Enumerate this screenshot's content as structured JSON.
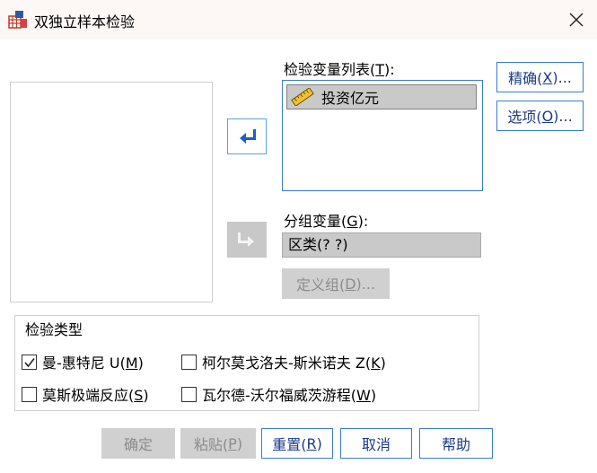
{
  "window": {
    "title": "双独立样本检验"
  },
  "test_variables": {
    "label_prefix": "检验变量列表(",
    "label_key": "T",
    "label_suffix": "):",
    "items": [
      "投资亿元"
    ]
  },
  "grouping_variable": {
    "label_prefix": "分组变量(",
    "label_key": "G",
    "label_suffix": "):",
    "value": "区类(? ?)"
  },
  "buttons": {
    "exact": {
      "prefix": "精确(",
      "key": "X",
      "suffix": ")..."
    },
    "options": {
      "prefix": "选项(",
      "key": "O",
      "suffix": ")..."
    },
    "define_groups": {
      "prefix": "定义组(",
      "key": "D",
      "suffix": ")..."
    },
    "ok": "确定",
    "paste": {
      "prefix": "粘贴(",
      "key": "P",
      "suffix": ")"
    },
    "reset": {
      "prefix": "重置(",
      "key": "R",
      "suffix": ")"
    },
    "cancel": "取消",
    "help": "帮助"
  },
  "test_type": {
    "legend": "检验类型",
    "options": [
      {
        "prefix": "曼-惠特尼 U(",
        "key": "M",
        "suffix": ")",
        "checked": true
      },
      {
        "prefix": "柯尔莫戈洛夫-斯米诺夫 Z(",
        "key": "K",
        "suffix": ")",
        "checked": false
      },
      {
        "prefix": "莫斯极端反应(",
        "key": "S",
        "suffix": ")",
        "checked": false
      },
      {
        "prefix": "瓦尔德-沃尔福威茨游程(",
        "key": "W",
        "suffix": ")",
        "checked": false
      }
    ]
  },
  "colors": {
    "accent": "#3a7bd5",
    "button_text": "#1b3a8a",
    "disabled_bg": "#d0d0d0",
    "selection_bg": "#c9c9c9"
  },
  "icons": {
    "app": "spss-dialog-icon",
    "close": "close-icon",
    "move_right_active": "arrow-left-icon",
    "move_right_disabled": "arrow-right-icon",
    "variable": "scale-ruler-icon",
    "checkbox_checked": "checkmark-icon"
  }
}
